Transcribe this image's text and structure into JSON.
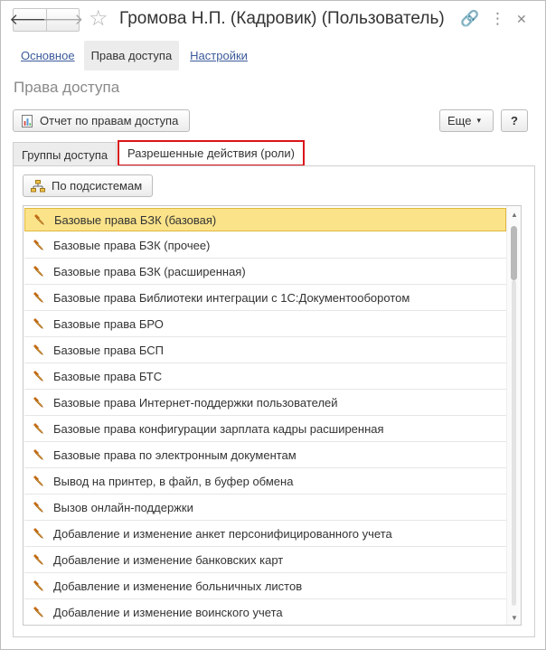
{
  "window": {
    "title": "Громова Н.П. (Кадровик) (Пользователь)",
    "back_glyph": "🡐",
    "forward_glyph": "🡒",
    "star_glyph": "☆",
    "link_glyph": "🔗",
    "menu_glyph": "⋮",
    "close_glyph": "✕"
  },
  "section_tabs": [
    {
      "label": "Основное",
      "active": false
    },
    {
      "label": "Права доступа",
      "active": true
    },
    {
      "label": "Настройки",
      "active": false
    }
  ],
  "page_title": "Права доступа",
  "toolbar": {
    "report_label": "Отчет по правам доступа",
    "more_label": "Еще",
    "more_arrow": "▾",
    "help_label": "?"
  },
  "inner_tabs": [
    {
      "label": "Группы доступа",
      "active": false
    },
    {
      "label": "Разрешенные действия (роли)",
      "active": true
    }
  ],
  "subsystems_label": "По подсистемам",
  "roles": [
    "Базовые права БЗК (базовая)",
    "Базовые права БЗК (прочее)",
    "Базовые права БЗК (расширенная)",
    "Базовые права Библиотеки интеграции с 1С:Документооборотом",
    "Базовые права БРО",
    "Базовые права БСП",
    "Базовые права БТС",
    "Базовые права Интернет-поддержки пользователей",
    "Базовые права конфигурации зарплата кадры расширенная",
    "Базовые права по электронным документам",
    "Вывод на принтер, в файл, в буфер обмена",
    "Вызов онлайн-поддержки",
    "Добавление и изменение анкет персонифицированного учета",
    "Добавление и изменение банковских карт",
    "Добавление и изменение больничных листов",
    "Добавление и изменение воинского учета"
  ],
  "selected_role_index": 0,
  "scroll": {
    "up_glyph": "▲",
    "down_glyph": "▼"
  },
  "colors": {
    "selection": "#fbe38a",
    "active_tab_border": "#d9141a",
    "link": "#3b5a9a",
    "pin": "#e08a1e"
  }
}
